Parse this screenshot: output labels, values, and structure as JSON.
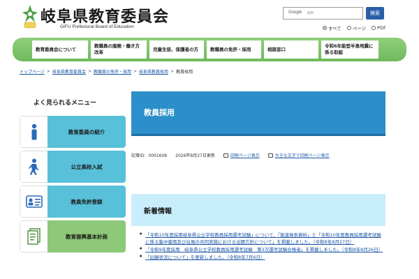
{
  "header": {
    "title": "岐阜県教育委員会",
    "subtitle": "GIFU Prefectural Board of Education",
    "search": {
      "brand": "Google",
      "brand_sub": "提供",
      "button_label": "検索"
    },
    "radios": [
      {
        "label": "すべて",
        "checked": true
      },
      {
        "label": "ページ",
        "checked": false
      },
      {
        "label": "PDF",
        "checked": false
      }
    ]
  },
  "gnav": [
    "教育委員会について",
    "教職員の服務・働き方改革",
    "児童生徒、保護者の方",
    "教職員の免許・採用",
    "相談窓口",
    "令和6年能登半島地震に係る取組"
  ],
  "breadcrumb": {
    "items": [
      "トップページ",
      "岐阜県教育委員会",
      "教職員の免許・採用",
      "岐阜県教員採用"
    ],
    "current": "教員採用",
    "separator": ">"
  },
  "side": {
    "title": "よく見られるメニュー",
    "items": [
      {
        "label": "教育委員の紹介",
        "icon": "person-icon"
      },
      {
        "label": "公立高校入試",
        "icon": "walking-person-icon"
      },
      {
        "label": "教員免許登録",
        "icon": "id-card-icon"
      },
      {
        "label": "教育振興基本計画",
        "icon": "document-icon"
      }
    ]
  },
  "main": {
    "page_title": "教員採用",
    "meta": {
      "record_id": "記事ID：0001608",
      "updated": "2026年8月27日更新",
      "print_link": "印刷ページ表示",
      "large_print_link": "大きな文字で印刷ページ表示"
    },
    "news_title": "新着情報",
    "news": [
      "「令和10年度採用岐阜県公立学校教員採用選考試験」について、「報道発表資料」と「令和10年度教員採用選考試験に係る集中豪雨及び台風の共同実施における出題方針について」を掲載しました。（令和8年8月27日）",
      "「令和9年度採用　岐阜県公立学校教員採用選考試験　第2次選考試験合格者」を掲載しました。（令和8年8月26日）",
      "「出願状況について」を更新しました。（令和8年7月6日）"
    ]
  }
}
